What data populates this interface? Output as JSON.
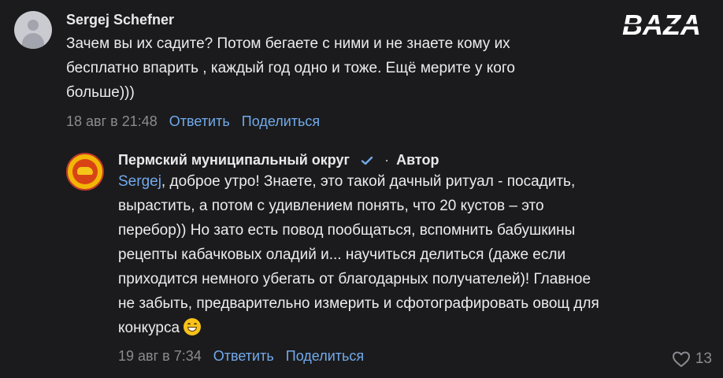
{
  "watermark": {
    "text": "BAZA"
  },
  "comments": [
    {
      "author": "Sergej Schefner",
      "avatar_icon": "default-user-avatar-icon",
      "lines": [
        "Зачем вы их садите? Потом бегаете с ними и не знаете кому их",
        "бесплатно впарить , каждый год одно и тоже. Ещё мерите у кого",
        "больше)))"
      ],
      "date": "18 авг в 21:48",
      "reply_label": "Ответить",
      "share_label": "Поделиться"
    },
    {
      "author": "Пермский муниципальный округ",
      "avatar_icon": "municipal-emblem-icon",
      "verified_icon": "checkmark-verified-icon",
      "separator": "·",
      "role": "Автор",
      "mention": "Sergej",
      "lines": [
        ", доброе утро! Знаете, это такой дачный ритуал - посадить,",
        "вырастить, а потом с удивлением понять, что 20 кустов – это",
        "перебор)) Но зато есть повод пообщаться, вспомнить бабушкины",
        "рецепты кабачковых оладий и... научиться делиться (даже если",
        "приходится немного убегать от благодарных получателей)! Главное",
        "не забыть, предварительно измерить и сфотографировать овощ для",
        "конкурса"
      ],
      "emoji": "grinning-face-emoji",
      "date": "19 авг в 7:34",
      "reply_label": "Ответить",
      "share_label": "Поделиться",
      "likes_icon": "heart-icon",
      "likes_count": "13"
    }
  ],
  "colors": {
    "background": "#1b1b1d",
    "link": "#71aaeb",
    "meta": "#8a8b90"
  }
}
